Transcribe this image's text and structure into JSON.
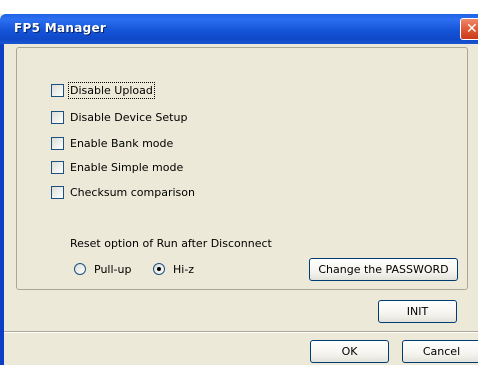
{
  "window": {
    "title": "FP5 Manager"
  },
  "options": [
    {
      "label": "Disable Upload",
      "checked": false
    },
    {
      "label": "Disable Device Setup",
      "checked": false
    },
    {
      "label": "Enable Bank mode",
      "checked": false
    },
    {
      "label": "Enable Simple mode",
      "checked": false
    },
    {
      "label": "Checksum comparison",
      "checked": false
    }
  ],
  "reset": {
    "label": "Reset option of Run after Disconnect",
    "options": [
      {
        "label": "Pull-up",
        "checked": false
      },
      {
        "label": "Hi-z",
        "checked": true
      }
    ]
  },
  "buttons": {
    "change_password": "Change the PASSWORD",
    "init": "INIT",
    "ok": "OK",
    "cancel": "Cancel"
  },
  "icons": {
    "close": "close-icon"
  },
  "colors": {
    "titlebar": "#0f49c8",
    "close_button": "#e05a35",
    "dialog_background": "#ece9d8"
  }
}
